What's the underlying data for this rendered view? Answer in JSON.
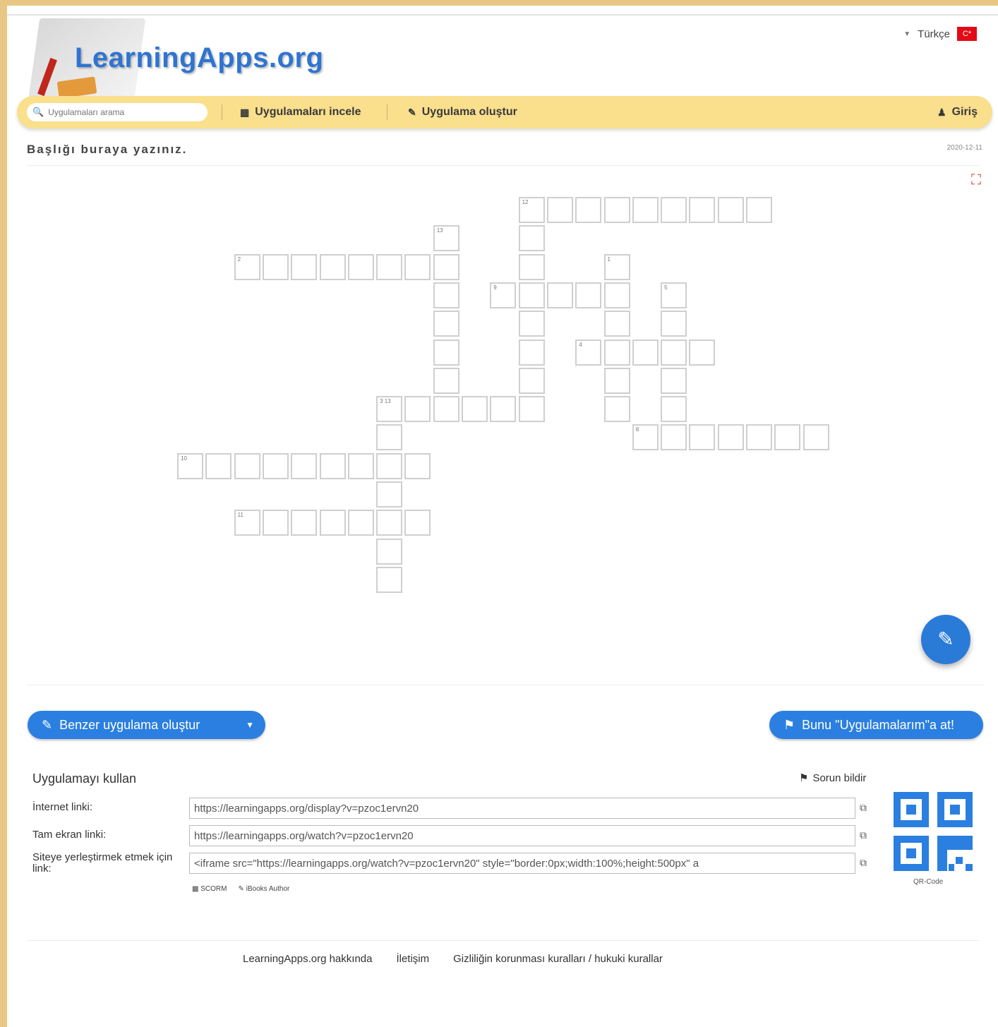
{
  "header": {
    "logo_text": "LearningApps.org",
    "language": "Türkçe",
    "flag_label": "C*"
  },
  "navbar": {
    "search_placeholder": "Uygulamaları arama",
    "browse_label": "Uygulamaları incele",
    "create_label": "Uygulama oluştur",
    "login_label": "Giriş"
  },
  "page": {
    "title": "Başlığı buraya yazınız.",
    "date": "2020-12-11"
  },
  "crossword": {
    "numbers": [
      "12",
      "13",
      "2",
      "1",
      "9",
      "5",
      "4",
      "3 13",
      "8",
      "10",
      "11"
    ]
  },
  "actions": {
    "similar_label": "Benzer uygulama oluştur",
    "save_label": "Bunu \"Uygulamalarım\"a at!"
  },
  "usage": {
    "heading": "Uygulamayı kullan",
    "report_label": "Sorun bildir",
    "internet_label": "İnternet linki:",
    "internet_value": "https://learningapps.org/display?v=pzoc1ervn20",
    "fullscreen_label": "Tam ekran linki:",
    "fullscreen_value": "https://learningapps.org/watch?v=pzoc1ervn20",
    "embed_label": "Siteye yerleştirmek etmek için link:",
    "embed_value": "<iframe src=\"https://learningapps.org/watch?v=pzoc1ervn20\" style=\"border:0px;width:100%;height:500px\" a",
    "scorm_label": "SCORM",
    "ibooks_label": "iBooks Author",
    "qr_caption": "QR-Code"
  },
  "footer": {
    "about": "LearningApps.org hakkında",
    "contact": "İletişim",
    "privacy": "Gizliliğin korunması kuralları / hukuki kurallar"
  }
}
